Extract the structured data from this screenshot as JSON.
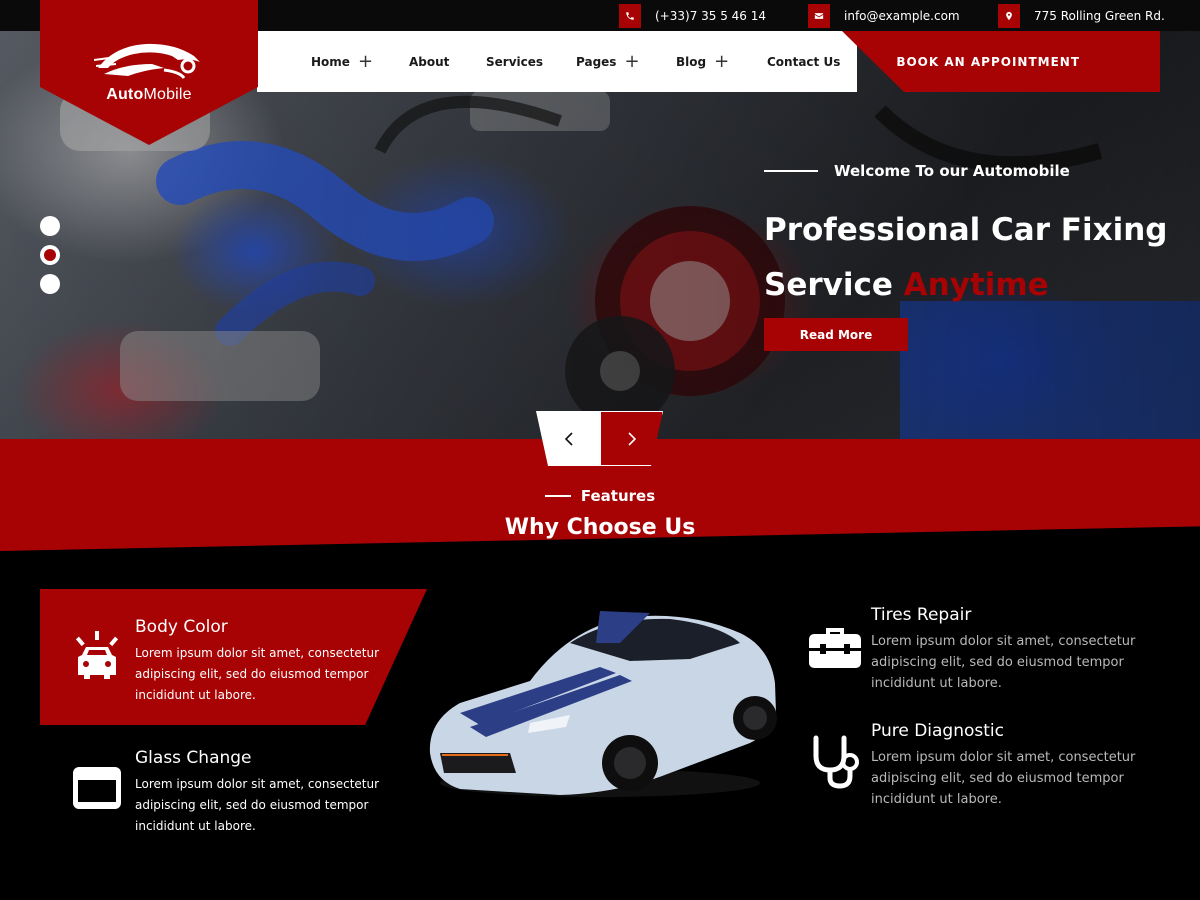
{
  "topbar": {
    "social": [
      {
        "icon": "facebook-icon"
      },
      {
        "icon": "twitter-icon"
      },
      {
        "icon": "pinterest-icon"
      },
      {
        "icon": "instagram-icon"
      }
    ],
    "phone": "(+33)7 35 5 46 14",
    "email": "info@example.com",
    "address": "775 Rolling Green Rd."
  },
  "logo": {
    "bold": "Auto",
    "regular": "Mobile"
  },
  "nav": {
    "items": [
      {
        "label": "Home",
        "has_submenu": true
      },
      {
        "label": "About",
        "has_submenu": false
      },
      {
        "label": "Services",
        "has_submenu": false
      },
      {
        "label": "Pages",
        "has_submenu": true
      },
      {
        "label": "Blog",
        "has_submenu": true
      },
      {
        "label": "Contact Us",
        "has_submenu": false
      }
    ],
    "plus_symbol": "+",
    "book_label": "BOOK AN APPOINTMENT"
  },
  "hero": {
    "welcome": "Welcome To our Automobile",
    "title_line1": "Professional Car Fixing",
    "title_line2_plain": "Service",
    "title_line2_accent": "Anytime",
    "button": "Read More",
    "active_slide": 2,
    "slide_count": 3
  },
  "features": {
    "label": "Features",
    "title": "Why Choose Us",
    "items": [
      {
        "title": "Body Color",
        "desc": "Lorem ipsum dolor sit amet, consectetur adipiscing elit, sed do eiusmod tempor incididunt ut labore.",
        "icon": "car-alert-icon",
        "highlighted": true
      },
      {
        "title": "Glass Change",
        "desc": "Lorem ipsum dolor sit amet, consectetur adipiscing elit, sed do eiusmod tempor incididunt ut labore.",
        "icon": "windshield-icon",
        "highlighted": false
      },
      {
        "title": "Tires Repair",
        "desc": "Lorem ipsum dolor sit amet, consectetur adipiscing elit, sed do eiusmod tempor incididunt ut labore.",
        "icon": "toolbox-icon",
        "highlighted": false
      },
      {
        "title": "Pure Diagnostic",
        "desc": "Lorem ipsum dolor sit amet, consectetur adipiscing elit, sed do eiusmod tempor incididunt ut labore.",
        "icon": "stethoscope-icon",
        "highlighted": false
      }
    ]
  },
  "colors": {
    "accent": "#a70204",
    "background": "#000000",
    "text": "#ffffff"
  }
}
